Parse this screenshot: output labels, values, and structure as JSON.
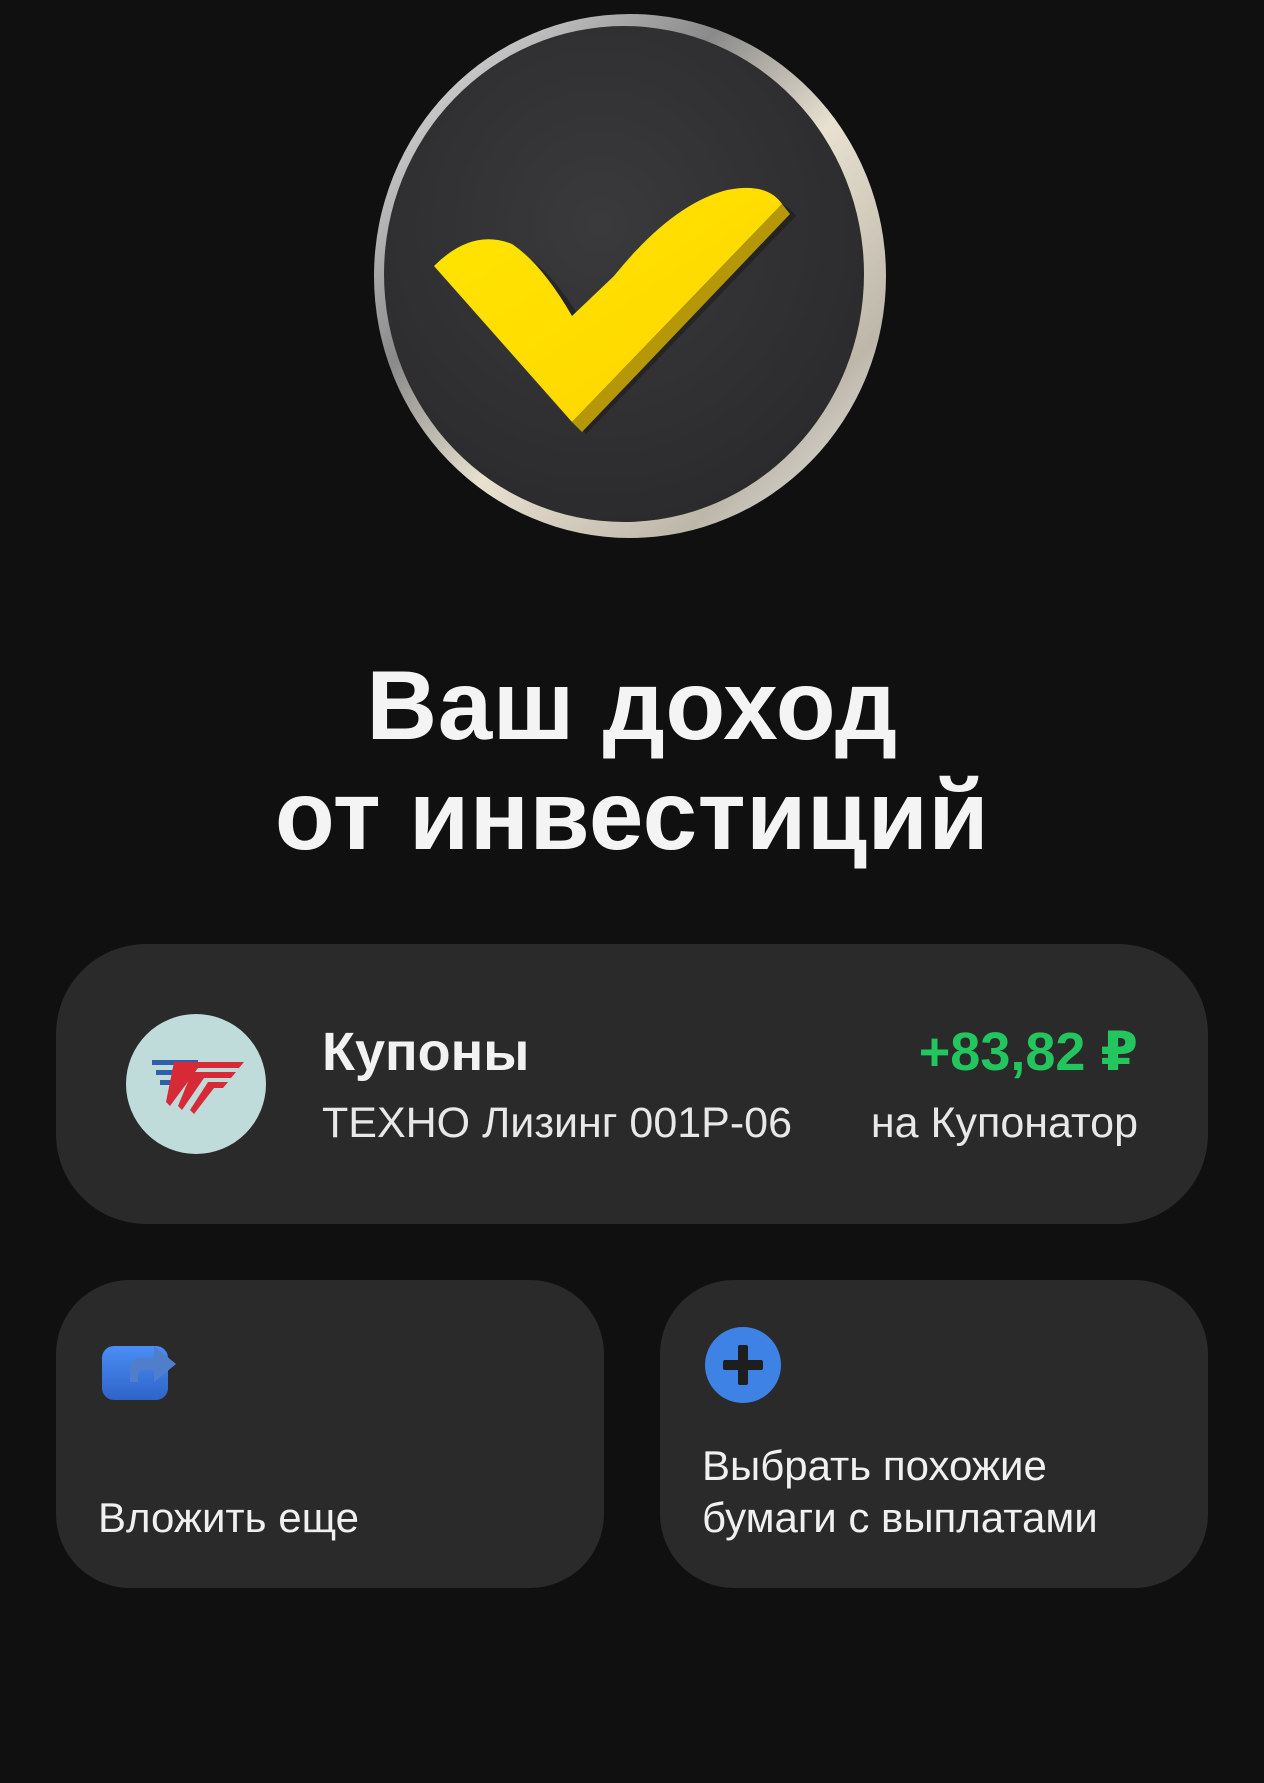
{
  "header": {
    "title_line1": "Ваш доход",
    "title_line2": "от инвестиций",
    "hero_icon": "checkmark-coin-icon"
  },
  "income": {
    "type": "Купоны",
    "bond": "ТЕХНО Лизинг 001P-06",
    "amount": "+83,82 ₽",
    "destination": "на Купонатор",
    "amount_color": "#22c55e",
    "logo_icon": "techno-leasing-logo"
  },
  "actions": {
    "invest_label": "Вложить еще",
    "invest_icon": "share-arrow-icon",
    "choose_label": "Выбрать похожие бумаги с выплатами",
    "choose_icon": "plus-circle-icon",
    "accent_color": "#3b82f6"
  },
  "colors": {
    "background": "#101010",
    "card": "#2a2a2b",
    "checkmark": "#ffdd00"
  }
}
